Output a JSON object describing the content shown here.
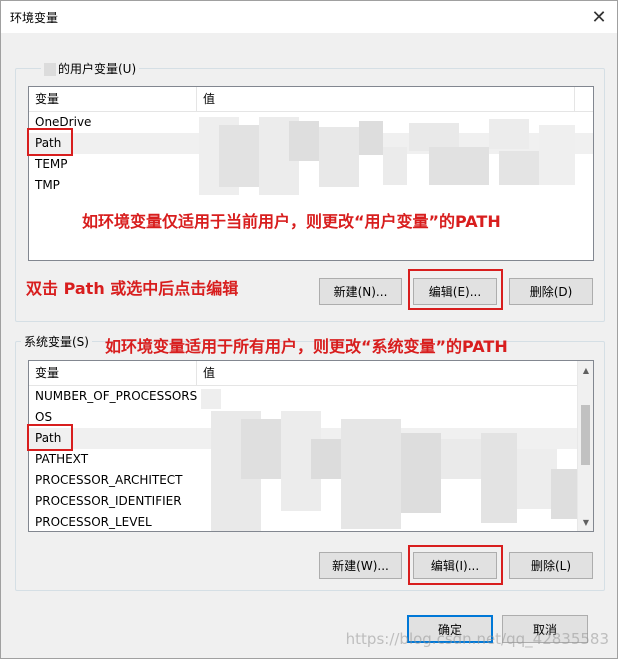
{
  "window": {
    "title": "环境变量",
    "close_glyph": "✕"
  },
  "user_group": {
    "label_suffix": "的用户变量(U)"
  },
  "user_list": {
    "col_var": "变量",
    "col_val": "值",
    "rows": [
      {
        "name": "OneDrive"
      },
      {
        "name": "Path"
      },
      {
        "name": "TEMP"
      },
      {
        "name": "TMP"
      }
    ]
  },
  "user_buttons": {
    "new": "新建(N)...",
    "edit": "编辑(E)...",
    "delete": "删除(D)"
  },
  "system_group": {
    "label": "系统变量(S)"
  },
  "system_list": {
    "col_var": "变量",
    "col_val": "值",
    "rows": [
      {
        "name": "NUMBER_OF_PROCESSORS"
      },
      {
        "name": "OS"
      },
      {
        "name": "Path"
      },
      {
        "name": "PATHEXT"
      },
      {
        "name": "PROCESSOR_ARCHITECT"
      },
      {
        "name": "PROCESSOR_IDENTIFIER"
      },
      {
        "name": "PROCESSOR_LEVEL"
      }
    ]
  },
  "system_buttons": {
    "new": "新建(W)...",
    "edit": "编辑(I)...",
    "delete": "删除(L)"
  },
  "dialog_buttons": {
    "ok": "确定",
    "cancel": "取消"
  },
  "annotations": {
    "user_hint": "如环境变量仅适用于当前用户，则更改“用户变量”的PATH",
    "dblclick_hint": "双击 Path 或选中后点击编辑",
    "system_hint": "如环境变量适用于所有用户，则更改“系统变量”的PATH"
  },
  "watermark": "https://blog.csdn.net/qq_42835583",
  "colors": {
    "annotation_red": "#d81e1e",
    "accent_blue": "#0078d7"
  }
}
